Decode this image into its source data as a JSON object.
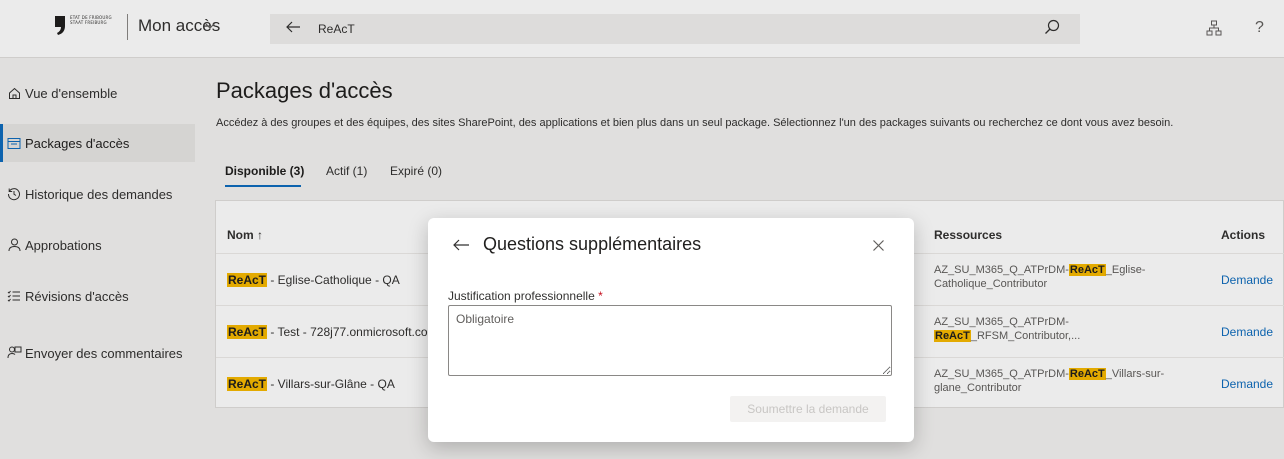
{
  "colors": {
    "accent": "#0f6cbd",
    "highlight": "#f7b900",
    "required": "#c50f1f"
  },
  "header": {
    "logo_text": [
      "ETAT DE FRIBOURG",
      "STAAT FREIBURG"
    ],
    "app_title": "Mon accès",
    "search_text": "ReAcT",
    "icons": [
      "back-arrow-icon",
      "search-icon",
      "org-chart-icon",
      "help-icon"
    ]
  },
  "sidebar": {
    "items": [
      {
        "label": "Vue d'ensemble",
        "icon": "home-icon",
        "active": false
      },
      {
        "label": "Packages d'accès",
        "icon": "package-icon",
        "active": true
      },
      {
        "label": "Historique des demandes",
        "icon": "history-icon",
        "active": false
      },
      {
        "label": "Approbations",
        "icon": "person-icon",
        "active": false
      },
      {
        "label": "Révisions d'accès",
        "icon": "checklist-icon",
        "active": false
      },
      {
        "label": "Envoyer des commentaires",
        "icon": "feedback-icon",
        "active": false
      }
    ]
  },
  "main": {
    "title": "Packages d'accès",
    "description": "Accédez à des groupes et des équipes, des sites SharePoint, des applications et bien plus dans un seul package. Sélectionnez l'un des packages suivants ou recherchez ce dont vous avez besoin.",
    "tabs": [
      {
        "label": "Disponible (3)",
        "active": true
      },
      {
        "label": "Actif (1)",
        "active": false
      },
      {
        "label": "Expiré (0)",
        "active": false
      }
    ],
    "table": {
      "headers": {
        "name": "Nom ↑",
        "resources": "Ressources",
        "actions": "Actions"
      },
      "rows": [
        {
          "name_hl": "ReAcT",
          "name_rest": " - Eglise-Catholique - QA",
          "res_a": "AZ_SU_M365_Q_ATPrDM-",
          "res_hl": "ReAcT",
          "res_b": "_Eglise-Catholique_Contributor",
          "action": "Demande"
        },
        {
          "name_hl": "ReAcT",
          "name_rest": " - Test - 728j77.onmicrosoft.com",
          "res_a": "AZ_SU_M365_Q_ATPrDM-",
          "res_hl": "ReAcT",
          "res_b": "_RFSM_Contributor,...",
          "action": "Demande"
        },
        {
          "name_hl": "ReAcT",
          "name_rest": " - Villars-sur-Glâne - QA",
          "res_a": "AZ_SU_M365_Q_ATPrDM-",
          "res_hl": "ReAcT",
          "res_b": "_Villars-sur-glane_Contributor",
          "action": "Demande"
        }
      ]
    }
  },
  "dialog": {
    "title": "Questions supplémentaires",
    "field_label": "Justification professionnelle",
    "required_mark": "*",
    "placeholder": "Obligatoire",
    "submit_label": "Soumettre la demande"
  }
}
